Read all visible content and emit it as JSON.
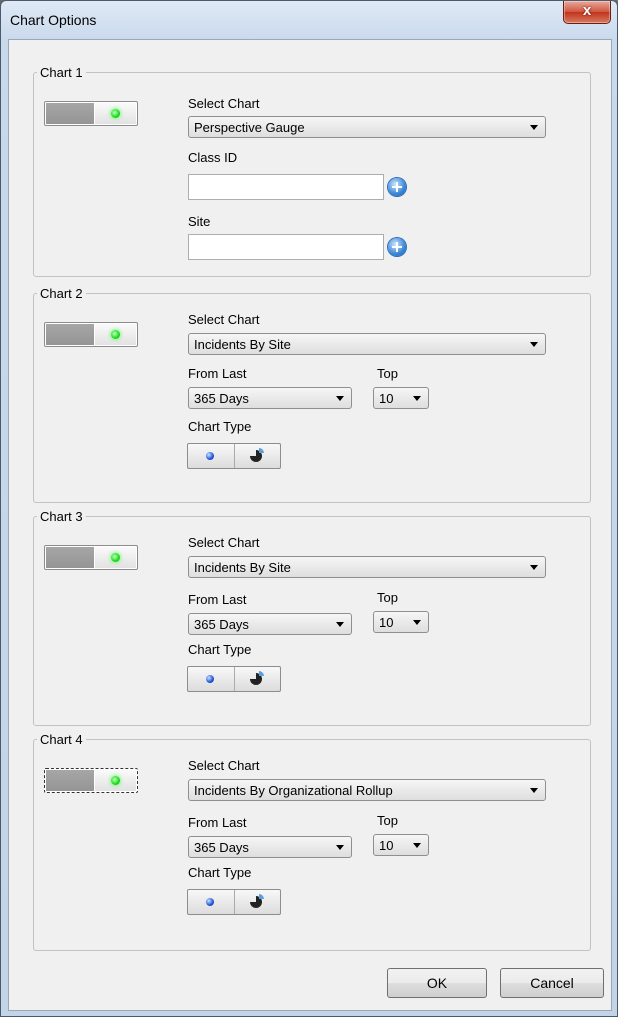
{
  "window": {
    "title": "Chart Options",
    "close_label": "x"
  },
  "labels": {
    "select_chart": "Select Chart",
    "class_id": "Class ID",
    "site": "Site",
    "from_last": "From Last",
    "top": "Top",
    "chart_type": "Chart Type"
  },
  "charts": [
    {
      "legend": "Chart 1",
      "select_value": "Perspective Gauge",
      "class_id_value": "",
      "site_value": ""
    },
    {
      "legend": "Chart 2",
      "select_value": "Incidents By Site",
      "from_last_value": "365 Days",
      "top_value": "10"
    },
    {
      "legend": "Chart 3",
      "select_value": "Incidents By Site",
      "from_last_value": "365 Days",
      "top_value": "10"
    },
    {
      "legend": "Chart 4",
      "select_value": "Incidents By Organizational Rollup",
      "from_last_value": "365 Days",
      "top_value": "10"
    }
  ],
  "buttons": {
    "ok": "OK",
    "cancel": "Cancel"
  },
  "colors": {
    "toggle_on_indicator": "#1ee01e",
    "close_button": "#c0351d"
  },
  "icons": {
    "add": "plus-circle-icon",
    "bar_chart_type": "bar-chart-icon",
    "pie_chart_type": "pie-chart-icon"
  }
}
